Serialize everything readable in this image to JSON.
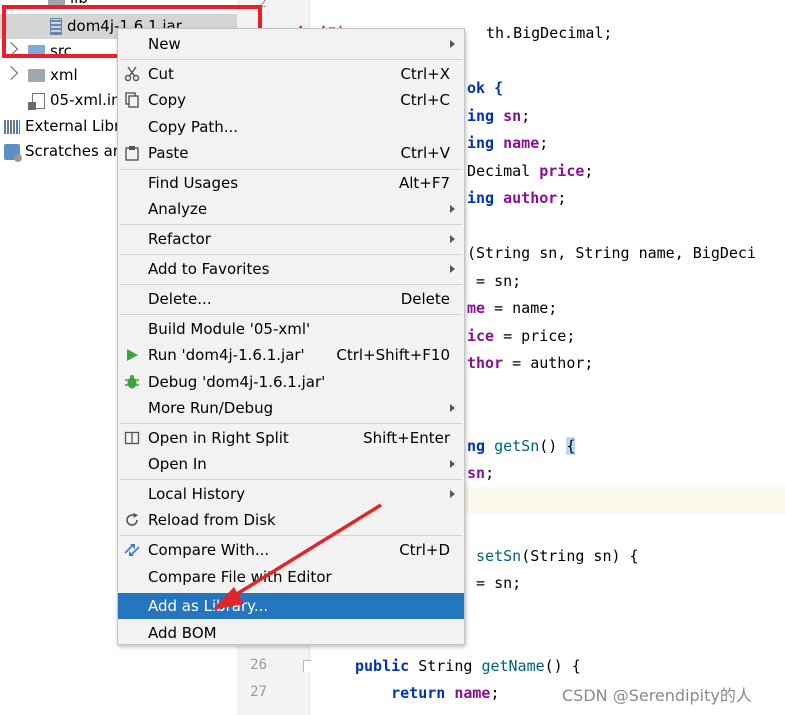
{
  "tree": {
    "items": [
      {
        "label": "lib",
        "icon": "folder-icon"
      },
      {
        "label": "dom4j-1.6.1.jar",
        "icon": "jar-icon"
      },
      {
        "label": "src",
        "icon": "source-folder-icon"
      },
      {
        "label": "xml",
        "icon": "folder-icon"
      },
      {
        "label": "05-xml.im",
        "icon": "module-file-icon"
      },
      {
        "label": "External Libr",
        "icon": "libraries-icon"
      },
      {
        "label": "Scratches an",
        "icon": "scratches-icon"
      }
    ]
  },
  "annotation": {
    "label": "右键",
    "color": "#ea1f2a"
  },
  "gutter": {
    "line_numbers": [
      "2",
      "26",
      "27"
    ]
  },
  "code": {
    "lines": [
      "th.BigDecimal;",
      "ok {",
      "ing sn;",
      "ing name;",
      "Decimal price;",
      "ing author;",
      "(String sn, String name, BigDeci",
      " = sn;",
      "me = name;",
      "ice = price;",
      "thor = author;",
      "ng getSn() {",
      "sn;",
      " setSn(String sn) {",
      " = sn;",
      "public String getName() {",
      "    return name;"
    ]
  },
  "menu": {
    "items": [
      {
        "label": "New",
        "shortcut": ""
      },
      {
        "label": "Cut",
        "shortcut": "Ctrl+X",
        "icon": "scissors-icon"
      },
      {
        "label": "Copy",
        "shortcut": "Ctrl+C",
        "icon": "copy-icon"
      },
      {
        "label": "Copy Path...",
        "shortcut": ""
      },
      {
        "label": "Paste",
        "shortcut": "Ctrl+V",
        "icon": "clipboard-icon"
      },
      {
        "label": "Find Usages",
        "shortcut": "Alt+F7"
      },
      {
        "label": "Analyze",
        "shortcut": ""
      },
      {
        "label": "Refactor",
        "shortcut": ""
      },
      {
        "label": "Add to Favorites",
        "shortcut": ""
      },
      {
        "label": "Delete...",
        "shortcut": "Delete"
      },
      {
        "label": "Build Module '05-xml'",
        "shortcut": ""
      },
      {
        "label": "Run 'dom4j-1.6.1.jar'",
        "shortcut": "Ctrl+Shift+F10",
        "icon": "run-icon"
      },
      {
        "label": "Debug 'dom4j-1.6.1.jar'",
        "shortcut": "",
        "icon": "debug-icon"
      },
      {
        "label": "More Run/Debug",
        "shortcut": ""
      },
      {
        "label": "Open in Right Split",
        "shortcut": "Shift+Enter",
        "icon": "split-icon"
      },
      {
        "label": "Open In",
        "shortcut": ""
      },
      {
        "label": "Local History",
        "shortcut": ""
      },
      {
        "label": "Reload from Disk",
        "shortcut": "",
        "icon": "reload-icon"
      },
      {
        "label": "Compare With...",
        "shortcut": "Ctrl+D",
        "icon": "compare-icon"
      },
      {
        "label": "Compare File with Editor",
        "shortcut": ""
      },
      {
        "label": "Add as Library...",
        "shortcut": ""
      },
      {
        "label": "Add BOM",
        "shortcut": ""
      }
    ],
    "highlight_color": "#2675bf"
  },
  "watermark": "CSDN @Serendipity的人"
}
